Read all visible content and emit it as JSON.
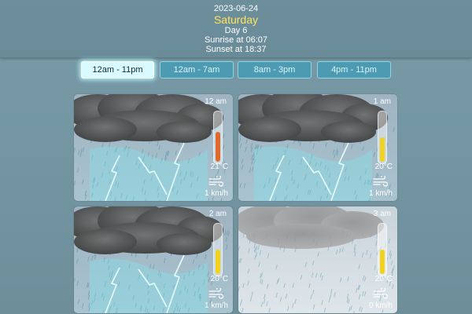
{
  "header": {
    "date": "2023-06-24",
    "dayname": "Saturday",
    "daynum": "Day 6",
    "sunrise": "Sunrise at 06:07",
    "sunset": "Sunset at 18:37"
  },
  "tabs": [
    {
      "label": "12am - 11pm",
      "active": true
    },
    {
      "label": "12am - 7am",
      "active": false
    },
    {
      "label": "8am - 3pm",
      "active": false
    },
    {
      "label": "4pm - 11pm",
      "active": false
    }
  ],
  "cards": [
    {
      "time": "12 am",
      "temp": "21°C",
      "wind": "1 km/h",
      "level": 0.62,
      "fill_color": "#e06a2e",
      "weather": "thunderstorm"
    },
    {
      "time": "1 am",
      "temp": "20°C",
      "wind": "1 km/h",
      "level": 0.5,
      "fill_color": "#f2d21a",
      "weather": "thunderstorm"
    },
    {
      "time": "2 am",
      "temp": "20°C",
      "wind": "1 km/h",
      "level": 0.5,
      "fill_color": "#f2d21a",
      "weather": "thunderstorm"
    },
    {
      "time": "3 am",
      "temp": "20°C",
      "wind": "0 km/h",
      "level": 0.5,
      "fill_color": "#f2d21a",
      "weather": "rain"
    }
  ]
}
